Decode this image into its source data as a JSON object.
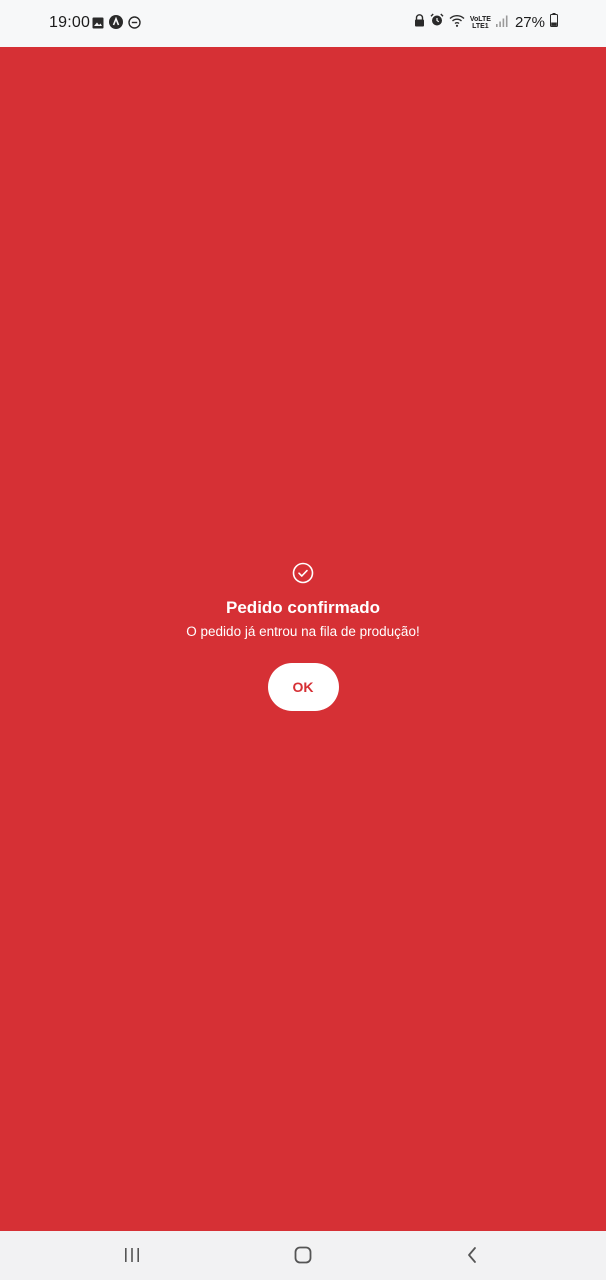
{
  "status_bar": {
    "time": "19:00",
    "volte_label_top": "VoLTE",
    "volte_label_bottom": "LTE1",
    "battery_percent": "27%",
    "left_icons": [
      "gallery-icon",
      "app-notification-icon",
      "do-not-disturb-icon"
    ],
    "right_icons": [
      "lock-icon",
      "alarm-icon",
      "wifi-icon",
      "volte-icon",
      "signal-icon",
      "battery-icon"
    ]
  },
  "dialog": {
    "icon": "check-circle-icon",
    "title": "Pedido confirmado",
    "subtitle": "O pedido já entrou na fila de produção!",
    "ok_label": "OK"
  },
  "colors": {
    "background": "#d63035",
    "status_bar": "#f7f8f9",
    "nav_bar": "#f2f2f3",
    "button_bg": "#ffffff",
    "text": "#ffffff"
  },
  "nav_bar": {
    "icons": [
      "recent-apps-icon",
      "home-icon",
      "back-icon"
    ]
  }
}
